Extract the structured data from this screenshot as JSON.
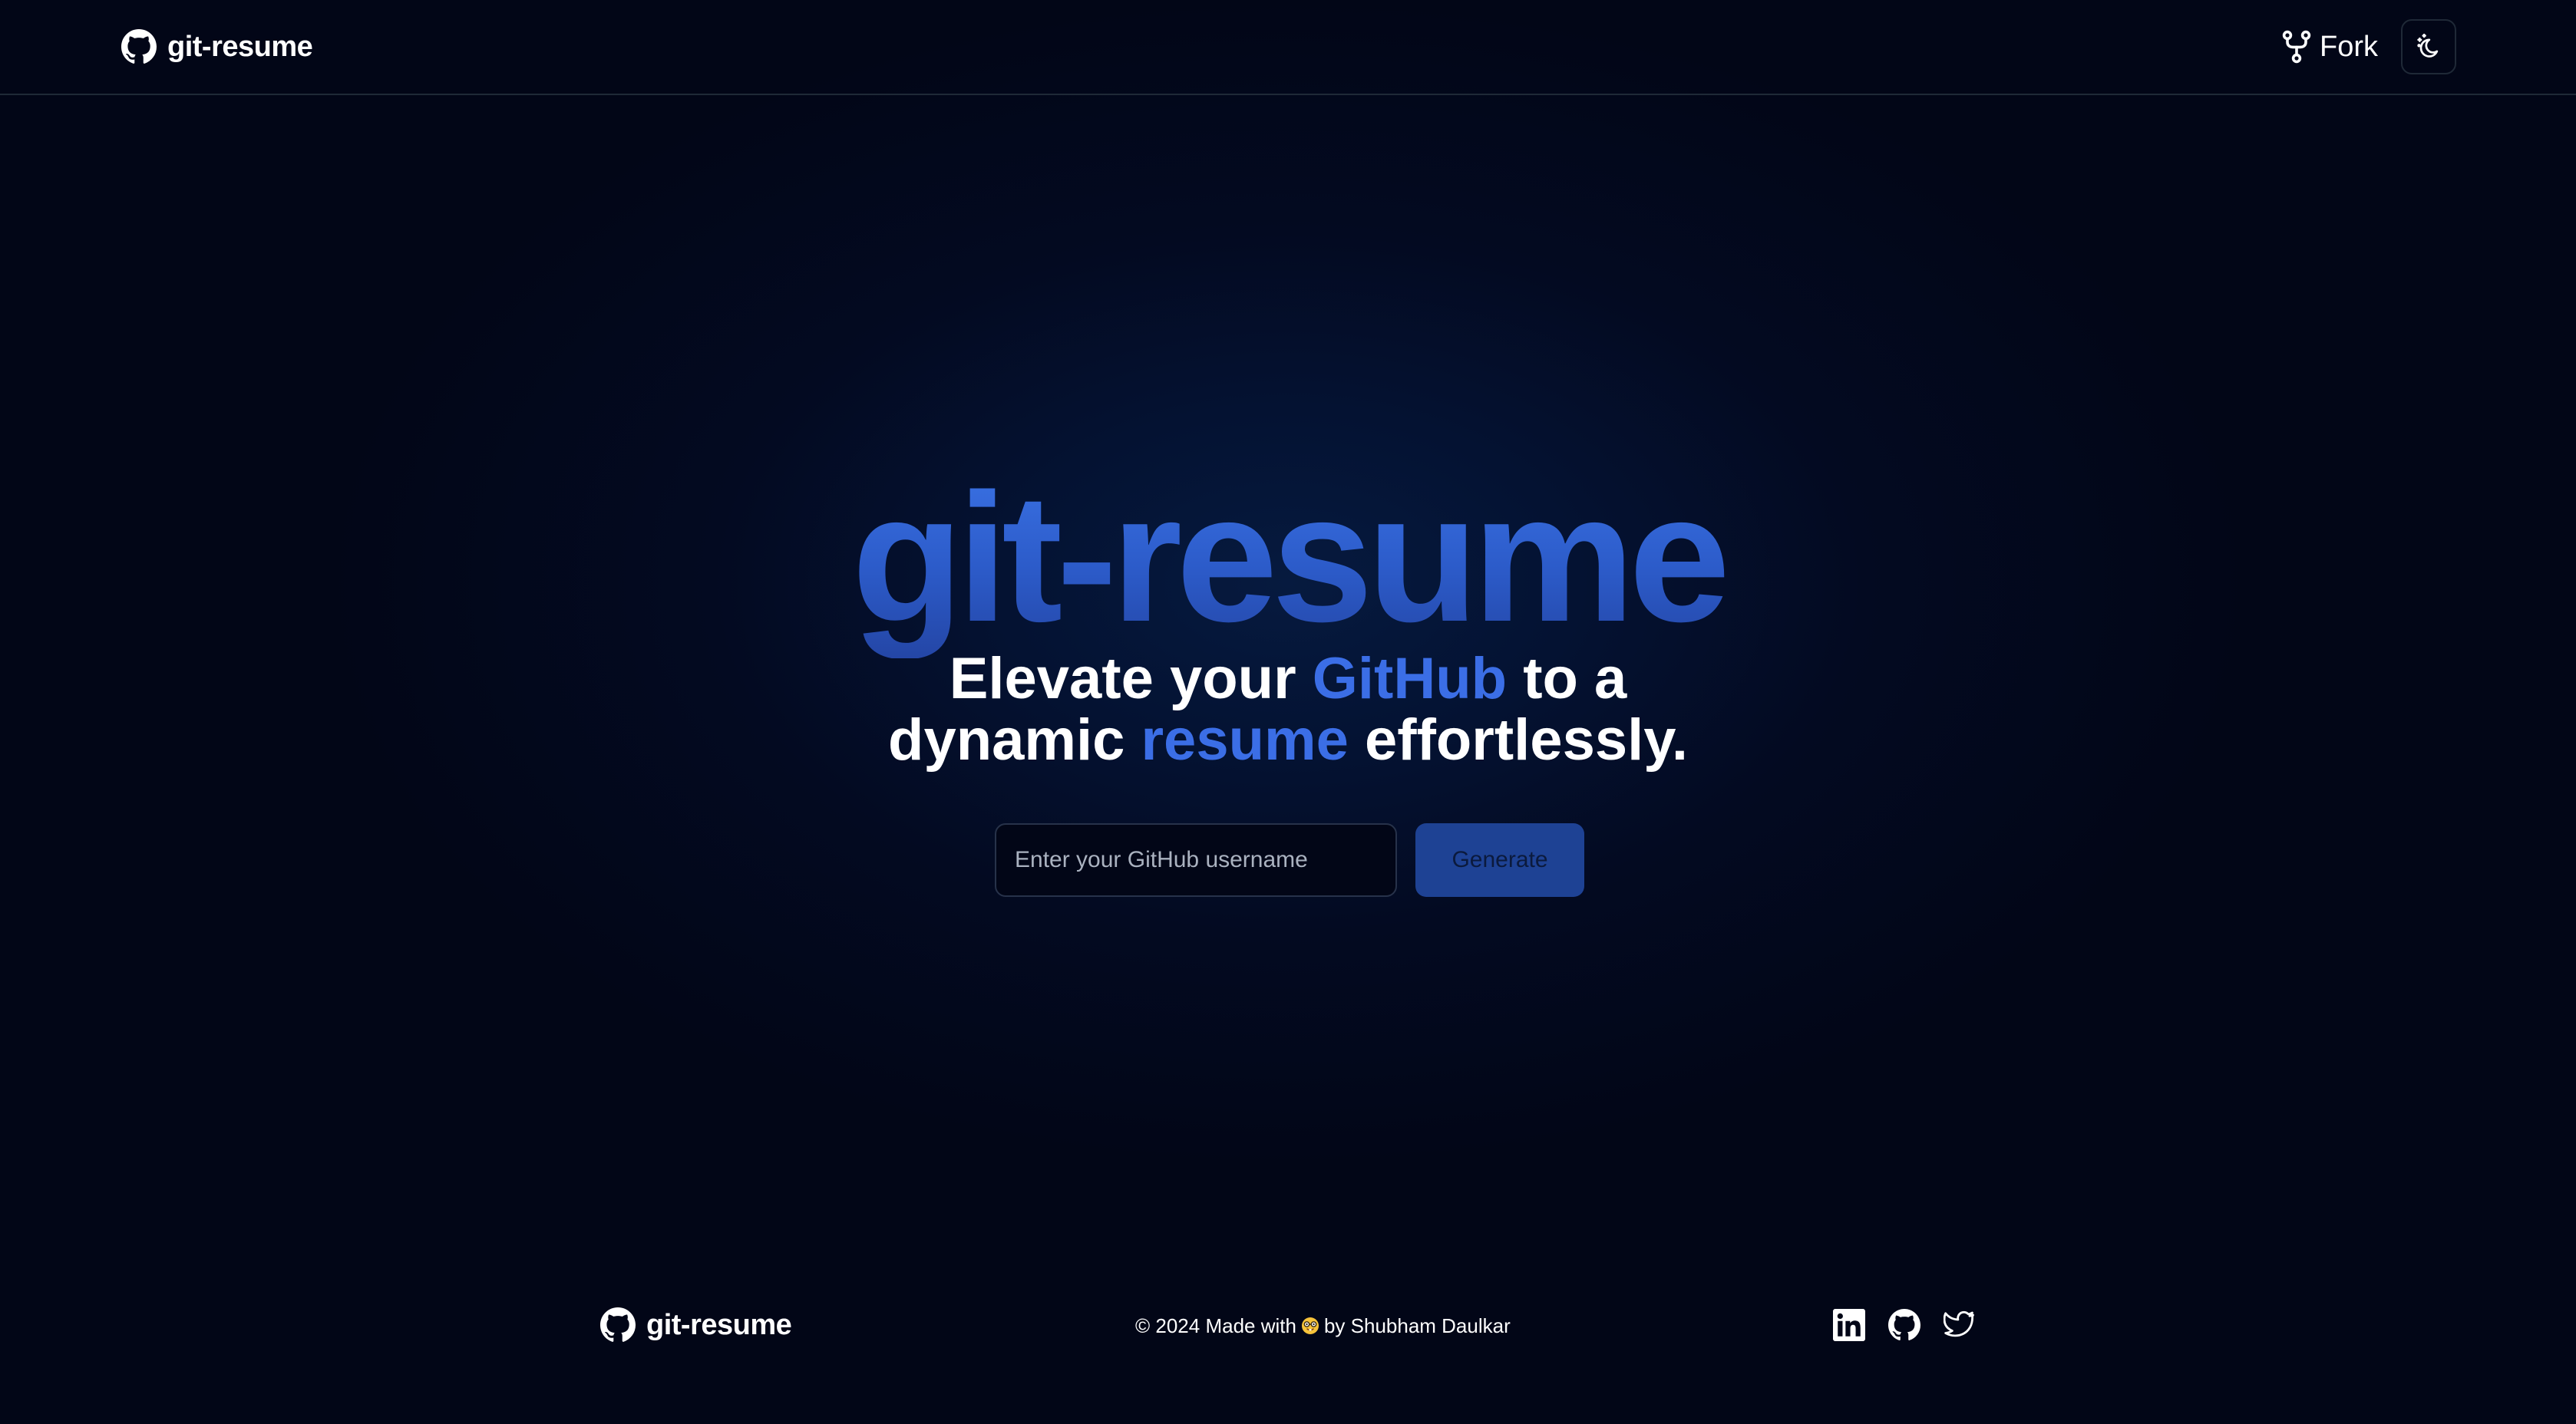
{
  "header": {
    "brand": {
      "icon": "github-icon",
      "name": "git-resume"
    },
    "fork": {
      "icon": "fork-icon",
      "label": "Fork"
    },
    "theme_toggle": {
      "icon": "moon-stars-icon"
    }
  },
  "hero": {
    "title": "git-resume",
    "tagline": {
      "part1": "Elevate your ",
      "highlight1": "GitHub",
      "part2": " to a",
      "part3": "dynamic ",
      "highlight2": "resume",
      "part4": " effortlessly."
    },
    "input": {
      "value": "",
      "placeholder": "Enter your GitHub username"
    },
    "button_label": "Generate"
  },
  "footer": {
    "brand": {
      "icon": "github-icon",
      "name": "git-resume"
    },
    "copyright_prefix": "© 2024 Made with",
    "emoji": "nerd-face-emoji-icon",
    "copyright_suffix": "by Shubham Daulkar",
    "socials": [
      {
        "name": "LinkedIn",
        "icon": "linkedin-icon"
      },
      {
        "name": "GitHub",
        "icon": "github-icon"
      },
      {
        "name": "Twitter",
        "icon": "twitter-icon"
      }
    ]
  },
  "colors": {
    "background": "#020617",
    "accent": "#3b6ee6",
    "title_gradient_top": "#3b73e6",
    "title_gradient_bottom": "#2446a6",
    "button_bg": "#1e4294",
    "border": "#1f2937"
  }
}
